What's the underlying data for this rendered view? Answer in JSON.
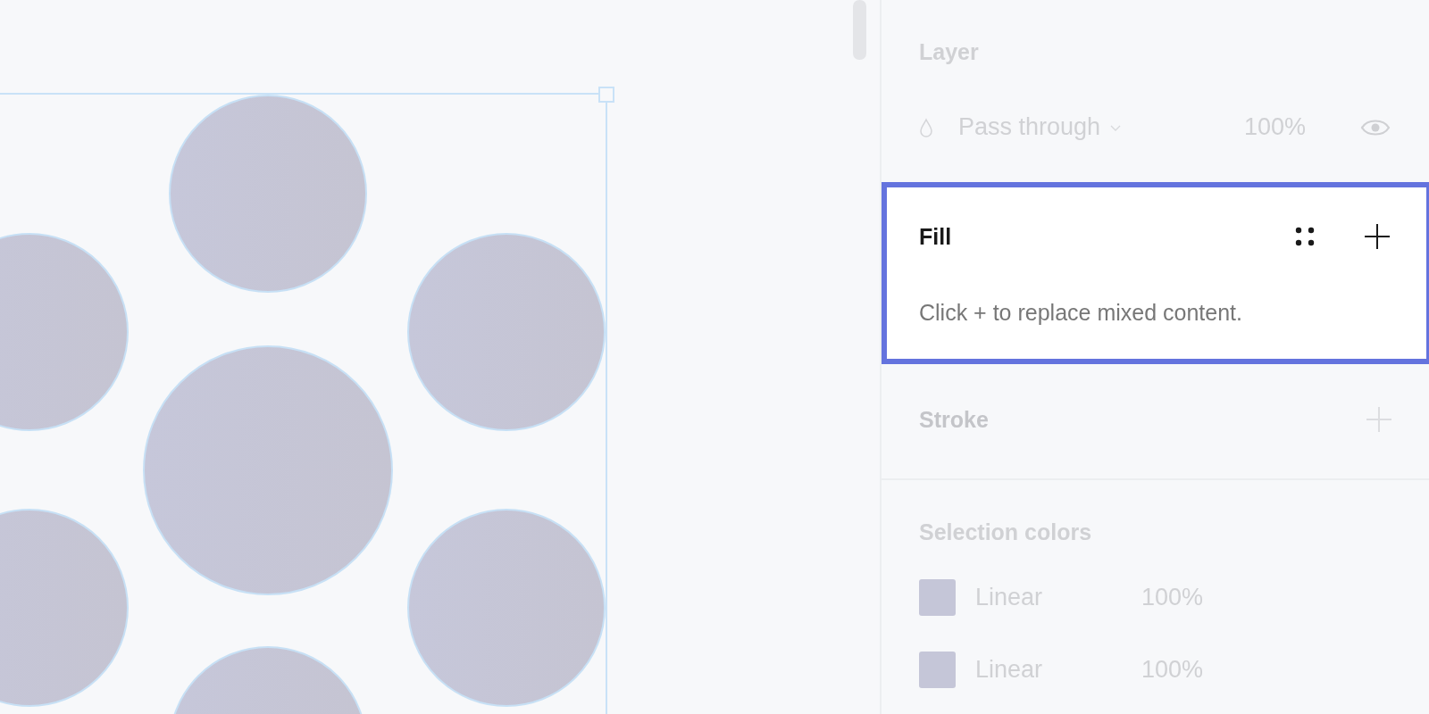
{
  "canvas": {
    "kind": "shapes"
  },
  "panel": {
    "sections": [
      {
        "kind": "layer",
        "title": "Layer",
        "highlighted": false,
        "blend_mode": "Pass through",
        "opacity": "100%",
        "visible": true
      },
      {
        "kind": "fill",
        "title": "Fill",
        "highlighted": true,
        "message": "Click + to replace mixed content."
      },
      {
        "kind": "stroke",
        "title": "Stroke",
        "highlighted": false
      },
      {
        "kind": "selection_colors",
        "title": "Selection colors",
        "highlighted": false,
        "items": [
          {
            "name": "Linear",
            "opacity": "100%",
            "color": "#c5c6d8"
          },
          {
            "name": "Linear",
            "opacity": "100%",
            "color": "#c5c6d8"
          }
        ]
      }
    ]
  }
}
